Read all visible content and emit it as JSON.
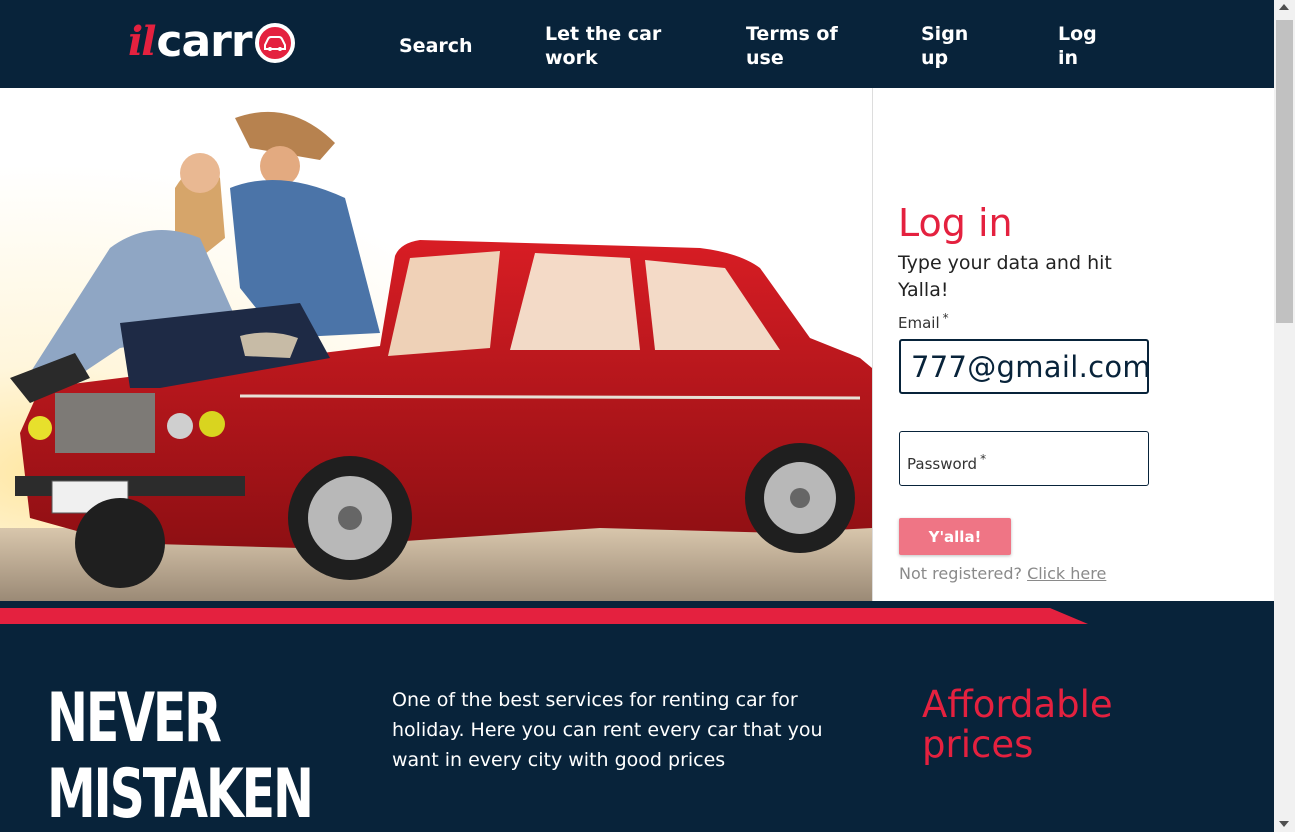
{
  "brand": {
    "logo_il": "il",
    "logo_carr": "carr",
    "primary_color": "#e4213f",
    "dark_color": "#08233a"
  },
  "nav": {
    "search": "Search",
    "let_car_work": "Let the car work",
    "terms": "Terms of use",
    "sign_up": "Sign up",
    "log_in": "Log in"
  },
  "login": {
    "title": "Log in",
    "subtitle": "Type your data and hit Yalla!",
    "email_label": "Email",
    "required_mark": "*",
    "email_value": "777@gmail.com",
    "password_label": "Password",
    "submit_label": "Y'alla!",
    "not_registered": "Not registered?",
    "click_here": "Click here"
  },
  "promo": {
    "headline_line1": "NEVER",
    "headline_line2": "MISTAKEN",
    "description": "One of the best services for renting car for holiday. Here you can rent every car that you want in every city with good prices",
    "affordable": "Affordable prices"
  },
  "hero": {
    "image_icon": "red-retro-car-photo"
  }
}
